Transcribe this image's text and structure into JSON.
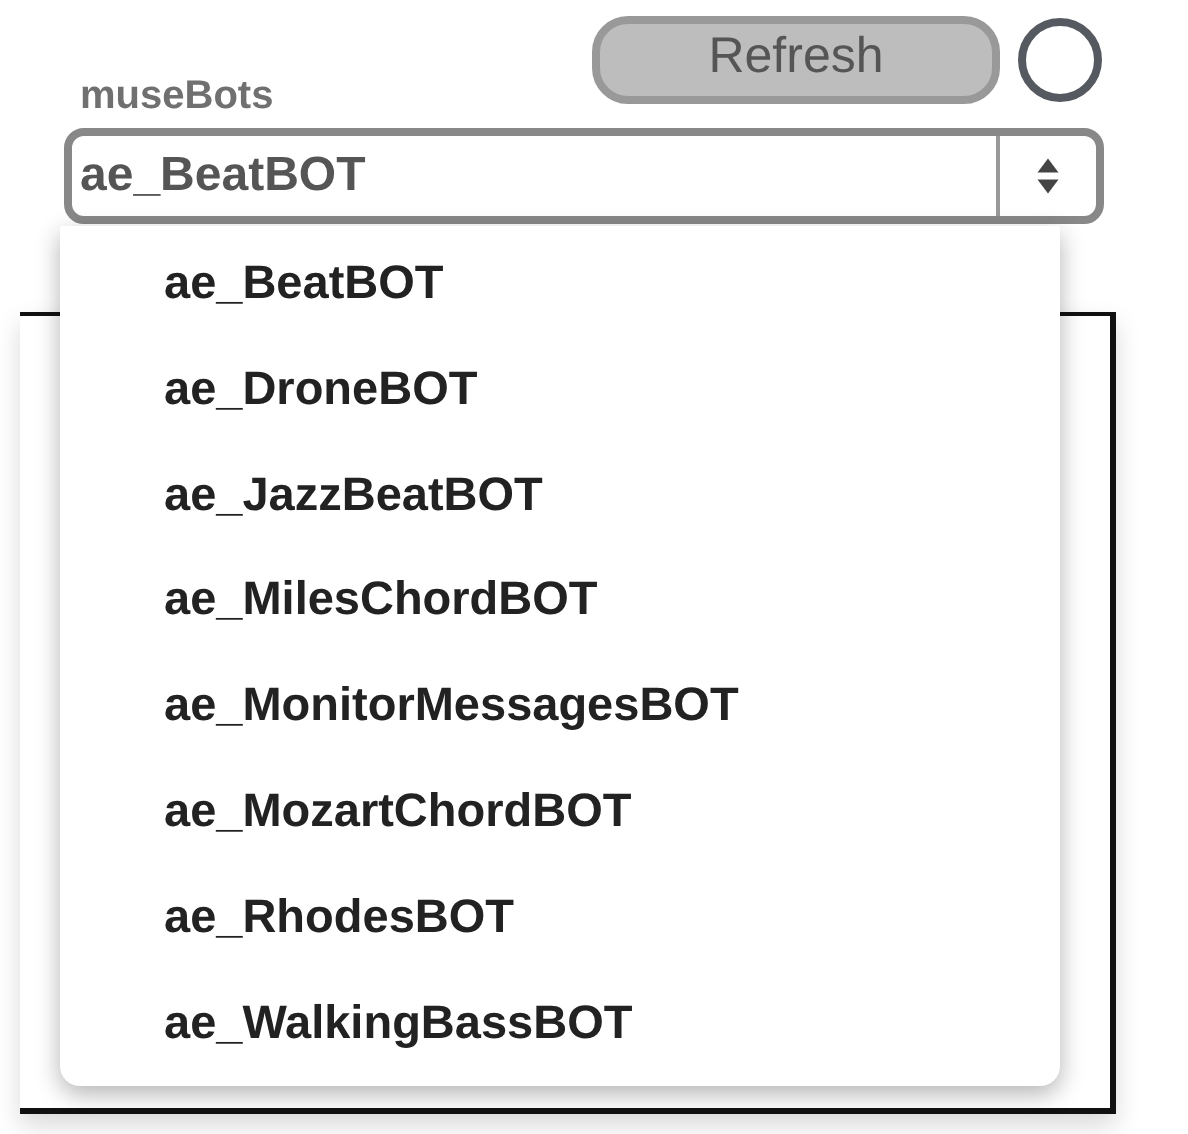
{
  "label": "museBots",
  "refresh_button": "Refresh",
  "select": {
    "value": "ae_BeatBOT"
  },
  "menu": {
    "items": [
      {
        "label": "ae_BeatBOT"
      },
      {
        "label": "ae_DroneBOT"
      },
      {
        "label": "ae_JazzBeatBOT"
      },
      {
        "label": "ae_MilesChordBOT"
      },
      {
        "label": "ae_MonitorMessagesBOT"
      },
      {
        "label": "ae_MozartChordBOT"
      },
      {
        "label": "ae_RhodesBOT"
      },
      {
        "label": "ae_WalkingBassBOT"
      }
    ]
  }
}
